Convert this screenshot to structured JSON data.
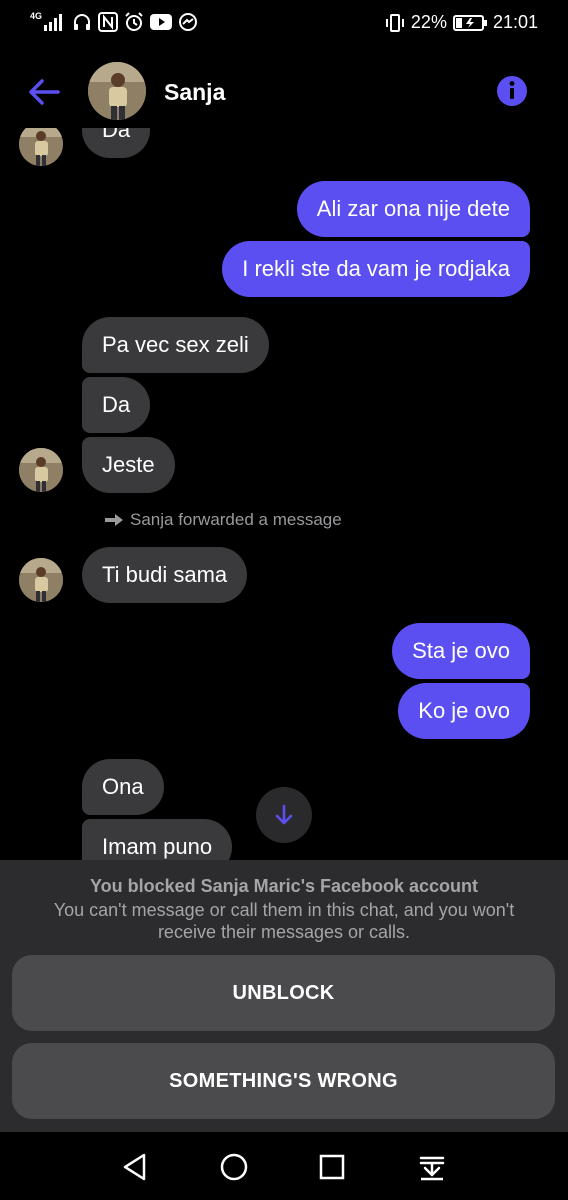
{
  "status_bar": {
    "network": "4G",
    "battery": "22%",
    "time": "21:01",
    "left_icons": [
      "signal-icon",
      "headphones-icon",
      "nfc-icon",
      "alarm-icon",
      "youtube-icon",
      "messenger-icon"
    ],
    "right_icons": [
      "vibrate-icon",
      "battery-icon"
    ]
  },
  "header": {
    "contact_name": "Sanja",
    "back_icon": "arrow-left-icon",
    "info_icon": "info-icon"
  },
  "messages": [
    {
      "id": "m0",
      "direction": "in",
      "text": "Da"
    },
    {
      "id": "m1",
      "direction": "out",
      "text": "Ali zar ona nije dete"
    },
    {
      "id": "m2",
      "direction": "out",
      "text": "I rekli ste da vam je rodjaka"
    },
    {
      "id": "m3",
      "direction": "in",
      "text": "Pa vec sex zeli"
    },
    {
      "id": "m4",
      "direction": "in",
      "text": "Da"
    },
    {
      "id": "m5",
      "direction": "in",
      "text": "Jeste"
    },
    {
      "id": "m6",
      "direction": "in",
      "text": "Ti budi sama"
    },
    {
      "id": "m7",
      "direction": "out",
      "text": "Sta je ovo"
    },
    {
      "id": "m8",
      "direction": "out",
      "text": "Ko je ovo"
    },
    {
      "id": "m9",
      "direction": "in",
      "text": "Ona"
    },
    {
      "id": "m10",
      "direction": "in",
      "text": "Imam puno"
    }
  ],
  "forward_note": "Sanja forwarded a message",
  "blocked": {
    "title": "You blocked Sanja Maric's Facebook account",
    "description": "You can't message or call them in this chat, and you won't receive their messages or calls.",
    "unblock_label": "UNBLOCK",
    "wrong_label": "SOMETHING'S WRONG"
  },
  "colors": {
    "accent": "#5b4ff2",
    "incoming_bubble": "#3a3a3c",
    "panel": "#2c2c2e",
    "button": "#4b4b4e"
  },
  "nav_icons": [
    "back-triangle-icon",
    "home-circle-icon",
    "recents-square-icon",
    "notification-pull-icon"
  ]
}
